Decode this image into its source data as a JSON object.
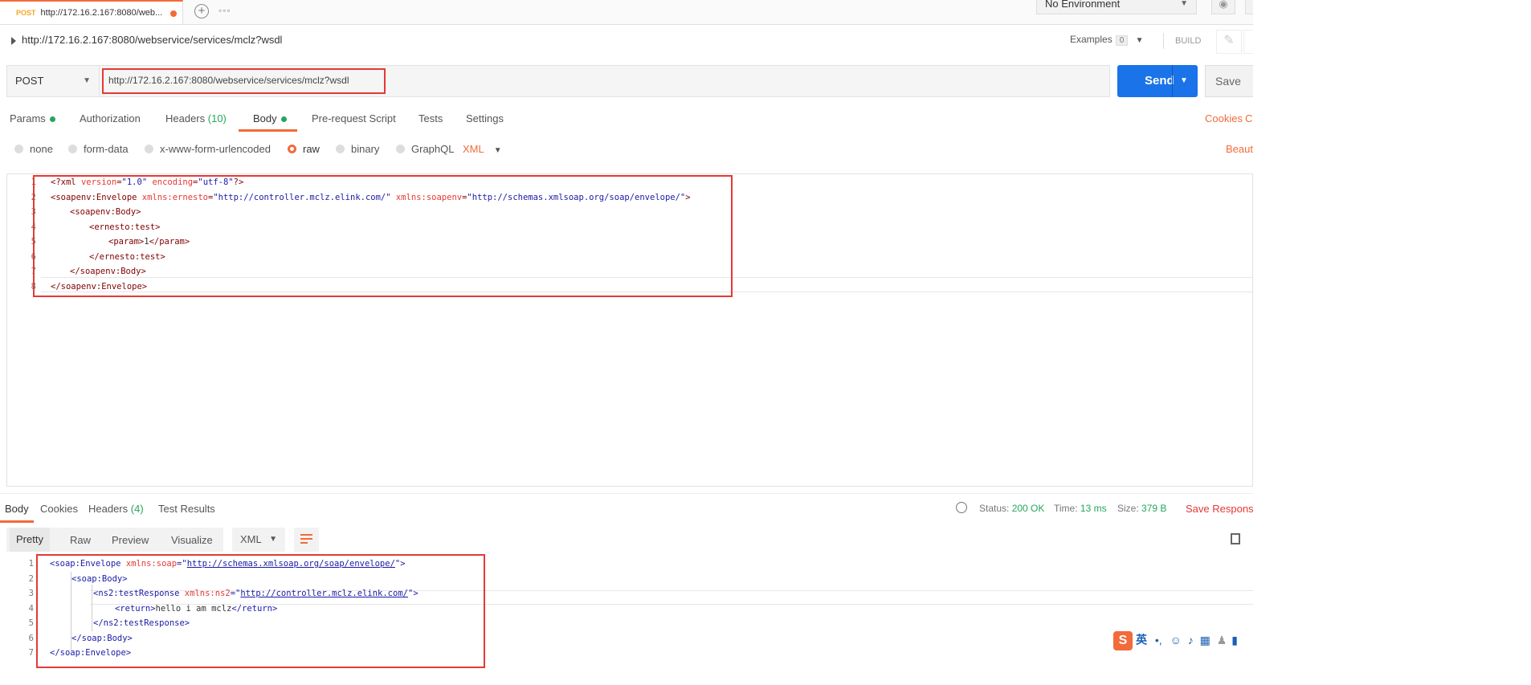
{
  "tab": {
    "method": "POST",
    "title": "http://172.16.2.167:8080/web..."
  },
  "environment": {
    "label": "No Environment"
  },
  "request": {
    "title": "http://172.16.2.167:8080/webservice/services/mclz?wsdl",
    "examples_label": "Examples",
    "examples_count": "0",
    "build_label": "BUILD",
    "method": "POST",
    "url": "http://172.16.2.167:8080/webservice/services/mclz?wsdl",
    "send_label": "Send",
    "save_label": "Save"
  },
  "req_tabs": {
    "params": "Params",
    "authorization": "Authorization",
    "headers": "Headers",
    "headers_count": "(10)",
    "body": "Body",
    "prerequest": "Pre-request Script",
    "tests": "Tests",
    "settings": "Settings",
    "cookies": "Cookies",
    "cookies_trunc": "C"
  },
  "body_types": {
    "none": "none",
    "form_data": "form-data",
    "urlencoded": "x-www-form-urlencoded",
    "raw": "raw",
    "binary": "binary",
    "graphql": "GraphQL",
    "format": "XML",
    "beautify": "Beauti"
  },
  "request_body_lines": [
    {
      "n": "1",
      "indent": 0,
      "parts": [
        {
          "c": "tag",
          "t": "<?xml "
        },
        {
          "c": "an",
          "t": "version"
        },
        {
          "c": "tag",
          "t": "="
        },
        {
          "c": "av",
          "t": "\"1.0\""
        },
        {
          "c": "tag",
          "t": " "
        },
        {
          "c": "an",
          "t": "encoding"
        },
        {
          "c": "tag",
          "t": "="
        },
        {
          "c": "av",
          "t": "\"utf-8\""
        },
        {
          "c": "tag",
          "t": "?>"
        }
      ]
    },
    {
      "n": "2",
      "indent": 0,
      "parts": [
        {
          "c": "tag",
          "t": "<soapenv:Envelope "
        },
        {
          "c": "an",
          "t": "xmlns:ernesto"
        },
        {
          "c": "tag",
          "t": "="
        },
        {
          "c": "av",
          "t": "\"http://controller.mclz.elink.com/\""
        },
        {
          "c": "tag",
          "t": " "
        },
        {
          "c": "an",
          "t": "xmlns:soapenv"
        },
        {
          "c": "tag",
          "t": "="
        },
        {
          "c": "av",
          "t": "\"http://schemas.xmlsoap.org/soap/envelope/\""
        },
        {
          "c": "tag",
          "t": ">"
        }
      ]
    },
    {
      "n": "3",
      "indent": 1,
      "parts": [
        {
          "c": "tag",
          "t": "<soapenv:Body>"
        }
      ]
    },
    {
      "n": "4",
      "indent": 2,
      "parts": [
        {
          "c": "tag",
          "t": "<ernesto:test>"
        }
      ]
    },
    {
      "n": "5",
      "indent": 3,
      "parts": [
        {
          "c": "tag",
          "t": "<param>"
        },
        {
          "c": "txt",
          "t": "1"
        },
        {
          "c": "tag",
          "t": "</param>"
        }
      ]
    },
    {
      "n": "6",
      "indent": 2,
      "parts": [
        {
          "c": "tag",
          "t": "</ernesto:test>"
        }
      ]
    },
    {
      "n": "7",
      "indent": 1,
      "parts": [
        {
          "c": "tag",
          "t": "</soapenv:Body>"
        }
      ]
    },
    {
      "n": "8",
      "indent": 0,
      "parts": [
        {
          "c": "tag",
          "t": "</soapenv:Envelope>"
        }
      ]
    }
  ],
  "response": {
    "tabs": {
      "body": "Body",
      "cookies": "Cookies",
      "headers": "Headers",
      "headers_count": "(4)",
      "test_results": "Test Results"
    },
    "status_label": "Status:",
    "status_value": "200 OK",
    "time_label": "Time:",
    "time_value": "13 ms",
    "size_label": "Size:",
    "size_value": "379 B",
    "save_response": "Save Response",
    "views": {
      "pretty": "Pretty",
      "raw": "Raw",
      "preview": "Preview",
      "visualize": "Visualize"
    },
    "format": "XML"
  },
  "response_body_lines": [
    {
      "n": "1",
      "indent": 0,
      "parts": [
        {
          "c": "tagb",
          "t": "<soap:Envelope "
        },
        {
          "c": "an",
          "t": "xmlns:soap"
        },
        {
          "c": "tagb",
          "t": "="
        },
        {
          "c": "av",
          "t": "\""
        },
        {
          "c": "link",
          "t": "http://schemas.xmlsoap.org/soap/envelope/"
        },
        {
          "c": "av",
          "t": "\""
        },
        {
          "c": "tagb",
          "t": ">"
        }
      ]
    },
    {
      "n": "2",
      "indent": 1,
      "parts": [
        {
          "c": "tagb",
          "t": "<soap:Body>"
        }
      ]
    },
    {
      "n": "3",
      "indent": 2,
      "parts": [
        {
          "c": "tagb",
          "t": "<ns2:testResponse "
        },
        {
          "c": "an",
          "t": "xmlns:ns2"
        },
        {
          "c": "tagb",
          "t": "="
        },
        {
          "c": "av",
          "t": "\""
        },
        {
          "c": "link",
          "t": "http://controller.mclz.elink.com/"
        },
        {
          "c": "av",
          "t": "\""
        },
        {
          "c": "tagb",
          "t": ">"
        }
      ]
    },
    {
      "n": "4",
      "indent": 3,
      "parts": [
        {
          "c": "tagb",
          "t": "<return>"
        },
        {
          "c": "txt",
          "t": "hello i am mclz"
        },
        {
          "c": "tagb",
          "t": "</return>"
        }
      ]
    },
    {
      "n": "5",
      "indent": 2,
      "parts": [
        {
          "c": "tagb",
          "t": "</ns2:testResponse>"
        }
      ]
    },
    {
      "n": "6",
      "indent": 1,
      "parts": [
        {
          "c": "tagb",
          "t": "</soap:Body>"
        }
      ]
    },
    {
      "n": "7",
      "indent": 0,
      "parts": [
        {
          "c": "tagb",
          "t": "</soap:Envelope>"
        }
      ]
    }
  ],
  "ime": {
    "logo": "S",
    "lang": "英"
  },
  "colors": {
    "accent": "#f26b3a",
    "send": "#1a73e8",
    "highlight": "#e53935",
    "success": "#26a65b"
  }
}
